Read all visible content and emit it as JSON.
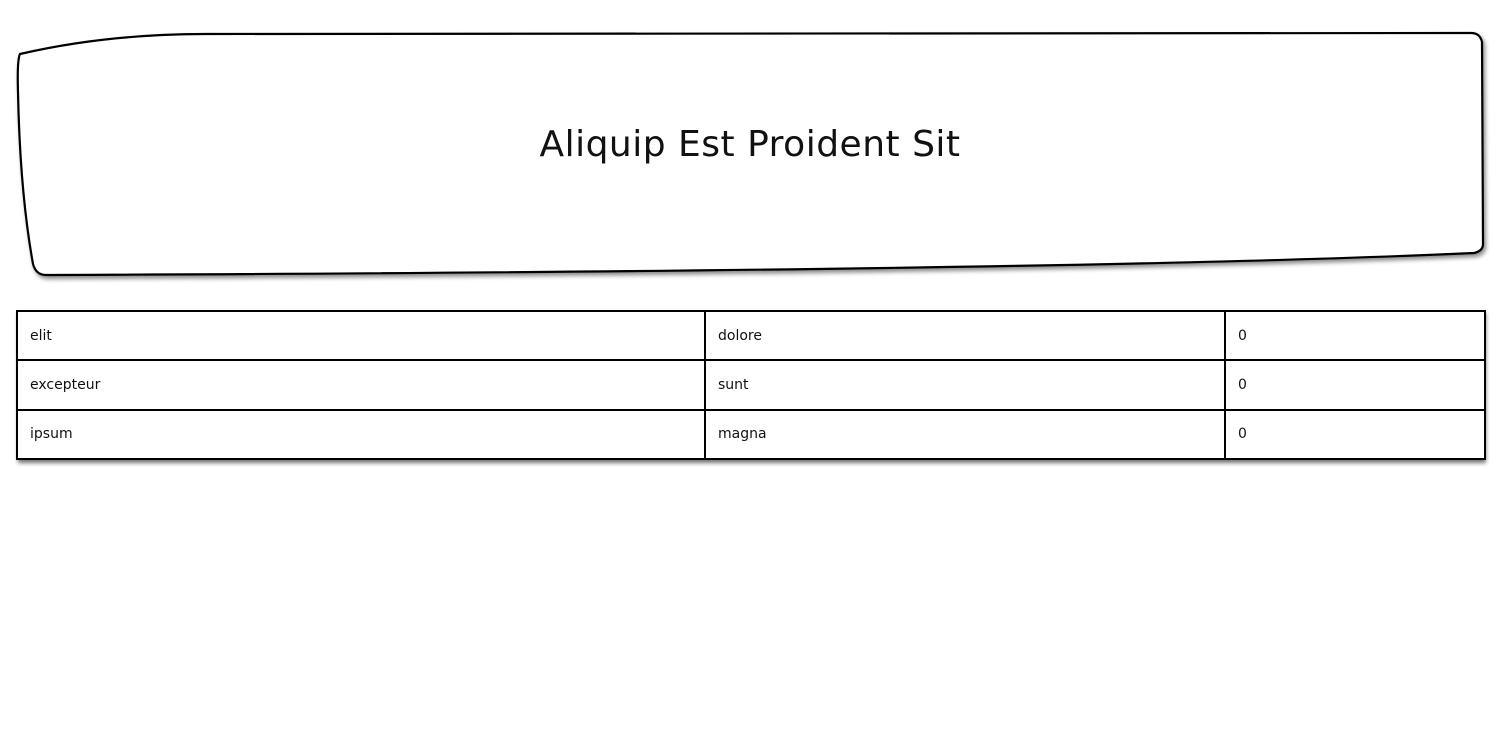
{
  "header": {
    "title": "Aliquip Est Proident Sit"
  },
  "table": {
    "rows": [
      {
        "col1": "elit",
        "col2": "dolore",
        "col3": "0"
      },
      {
        "col1": "excepteur",
        "col2": "sunt",
        "col3": "0"
      },
      {
        "col1": "ipsum",
        "col2": "magna",
        "col3": "0"
      }
    ]
  }
}
